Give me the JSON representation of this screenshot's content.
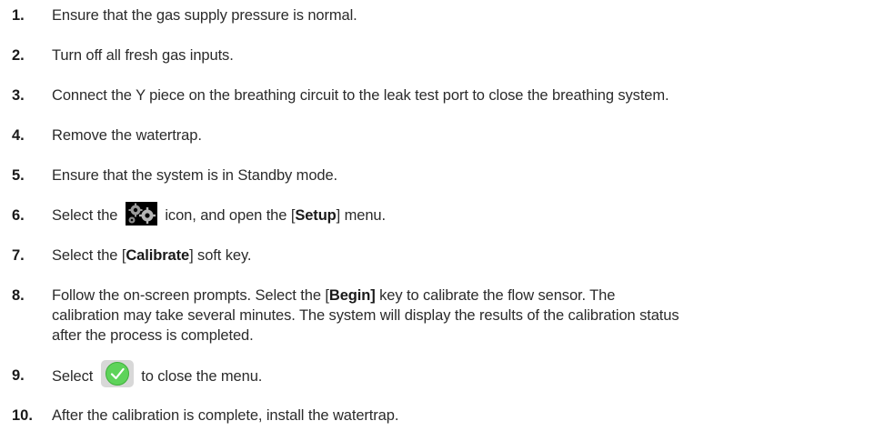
{
  "steps": [
    {
      "num": "1.",
      "text": "Ensure that the gas supply pressure is normal."
    },
    {
      "num": "2.",
      "text": "Turn off all fresh gas inputs."
    },
    {
      "num": "3.",
      "text": "Connect the Y piece on the breathing circuit to the leak test port to close the breathing system."
    },
    {
      "num": "4.",
      "text": "Remove the watertrap."
    },
    {
      "num": "5.",
      "text": "Ensure that the system is in Standby mode."
    },
    {
      "num": "6.",
      "pre": "Select the",
      "post": "icon, and open the [",
      "bold": "Setup",
      "post2": "] menu."
    },
    {
      "num": "7.",
      "pre": "Select the [",
      "bold": "Calibrate",
      "post": "] soft key."
    },
    {
      "num": "8.",
      "pre": "Follow the on-screen prompts. Select the [",
      "bold": "Begin]",
      "post": " key to calibrate the flow sensor. The",
      "line2": "calibration may take several minutes. The system will display the results of the calibration status",
      "line3": "after the process is completed."
    },
    {
      "num": "9.",
      "pre": "Select",
      "post": "to close the menu."
    },
    {
      "num": "10.",
      "text": "After the calibration is complete, install the watertrap."
    }
  ],
  "icons": {
    "gear": "gear-icon",
    "check": "checkmark-icon",
    "check_color": "#5ed35a",
    "gear_bg": "#000000"
  }
}
